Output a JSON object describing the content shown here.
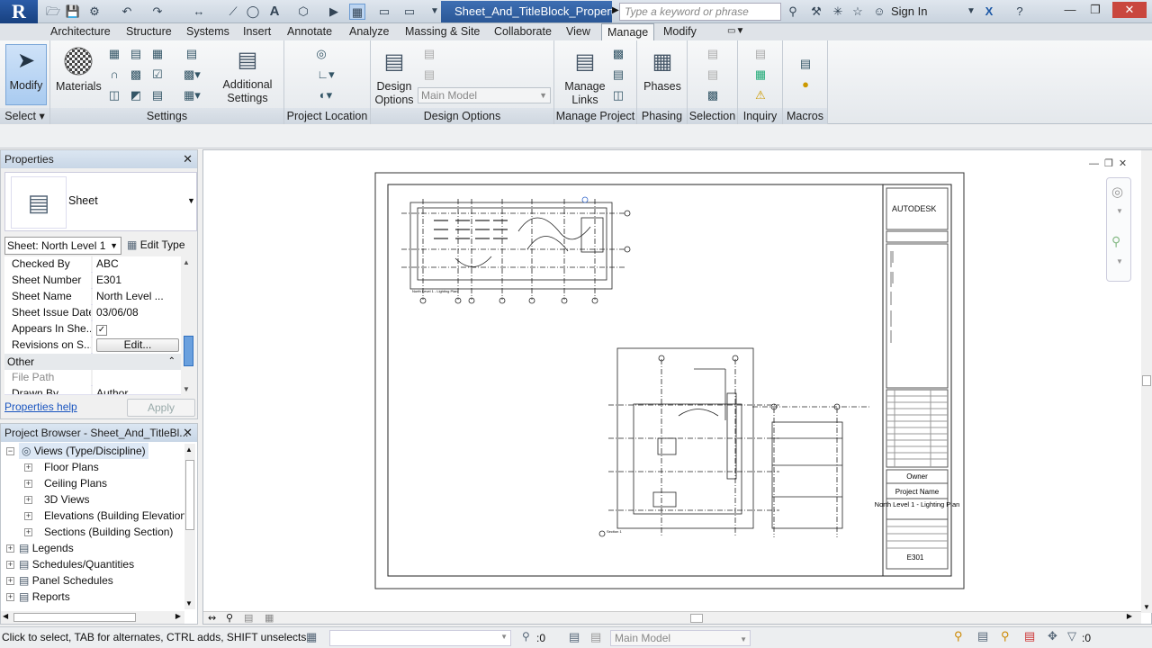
{
  "titlebar": {
    "doc_title": "Sheet_And_TitleBlock_Properti...",
    "search_placeholder": "Type a keyword or phrase",
    "signin": "Sign In",
    "app_letter": "R"
  },
  "tabs": [
    "Architecture",
    "Structure",
    "Systems",
    "Insert",
    "Annotate",
    "Analyze",
    "Massing & Site",
    "Collaborate",
    "View",
    "Manage",
    "Modify"
  ],
  "active_tab": "Manage",
  "ribbon": {
    "modify_label": "Modify",
    "materials_label": "Materials",
    "additional_settings_label": "Additional Settings",
    "design_options_label": "Design Options",
    "main_model_value": "Main Model",
    "manage_links_label": "Manage Links",
    "phases_label": "Phases",
    "panels": {
      "select": "Select",
      "settings": "Settings",
      "project_location": "Project Location",
      "design_options": "Design Options",
      "manage_project": "Manage Project",
      "phasing": "Phasing",
      "selection": "Selection",
      "inquiry": "Inquiry",
      "macros": "Macros"
    }
  },
  "properties": {
    "title": "Properties",
    "type_name": "Sheet",
    "instance_filter": "Sheet: North Level 1",
    "edit_type": "Edit Type",
    "rows": [
      {
        "key": "Checked By",
        "value": "ABC"
      },
      {
        "key": "Sheet Number",
        "value": "E301"
      },
      {
        "key": "Sheet Name",
        "value": "North Level ..."
      },
      {
        "key": "Sheet Issue Date",
        "value": "03/06/08"
      },
      {
        "key": "Appears In She...",
        "value": ""
      },
      {
        "key": "Revisions on S...",
        "value": "Edit..."
      }
    ],
    "group_other": "Other",
    "file_path_key": "File Path",
    "drawn_by_key": "Drawn By",
    "drawn_by_value": "Author",
    "help_link": "Properties help",
    "apply": "Apply"
  },
  "browser": {
    "title": "Project Browser - Sheet_And_TitleBl...",
    "root": "Views (Type/Discipline)",
    "children": [
      "Floor Plans",
      "Ceiling Plans",
      "3D Views",
      "Elevations (Building Elevation",
      "Sections (Building Section)"
    ],
    "top": [
      "Legends",
      "Schedules/Quantities",
      "Panel Schedules",
      "Reports"
    ]
  },
  "sheet": {
    "logo": "AUTODESK",
    "owner": "Owner",
    "project_name": "Project Name",
    "sheet_title": "North Level 1 - Lighting Plan",
    "sheet_number": "E301",
    "plan_caption": "North Level 1 - Lighting Plan",
    "section_caption": "Section 1"
  },
  "status": {
    "message": "Click to select, TAB for alternates, CTRL adds, SHIFT unselects.",
    "count_left": ":0",
    "model": "Main Model",
    "count_right": ":0"
  }
}
